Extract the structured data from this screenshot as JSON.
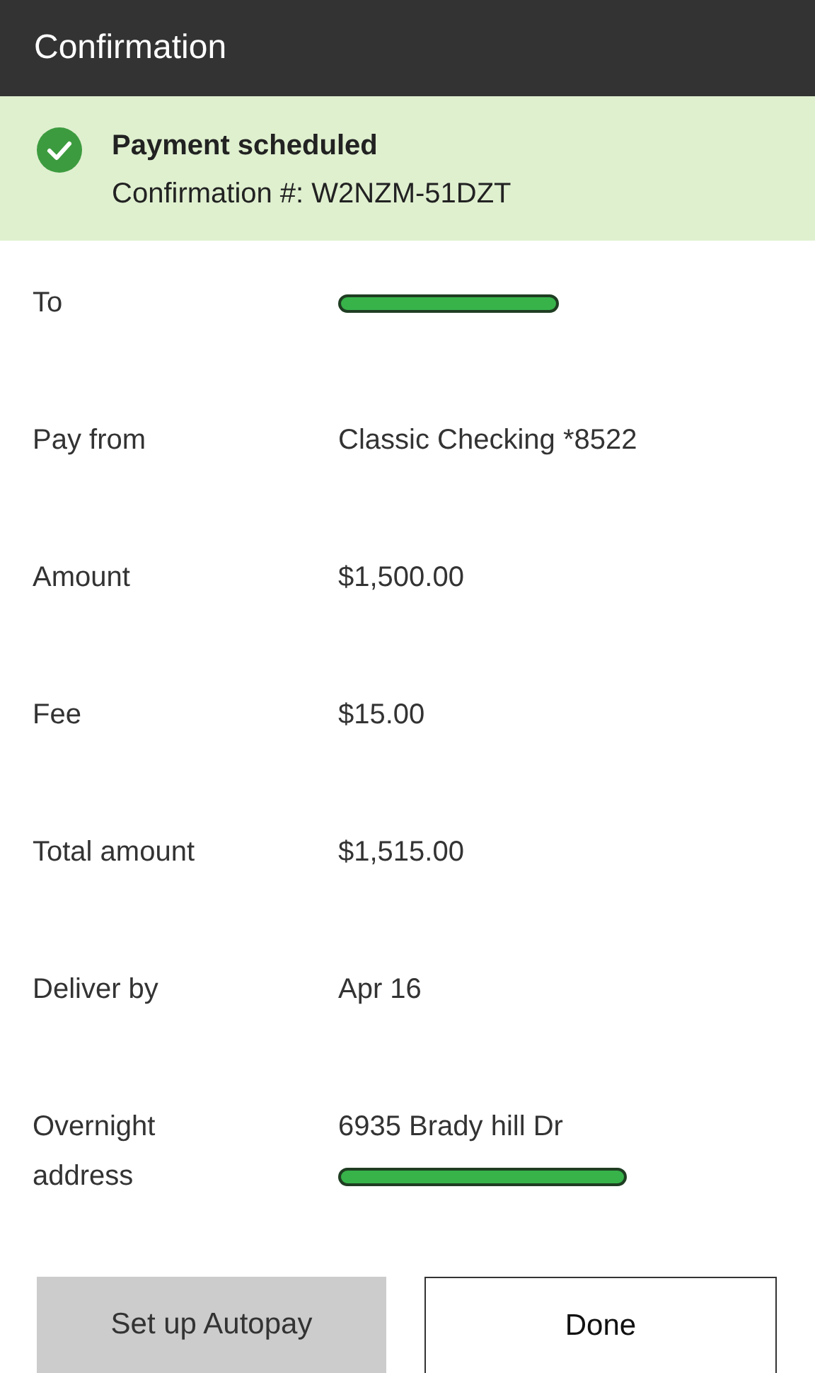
{
  "header": {
    "title": "Confirmation"
  },
  "banner": {
    "title": "Payment scheduled",
    "subtitle": "Confirmation #: W2NZM-51DZT"
  },
  "rows": [
    {
      "label": "To",
      "value": [
        {
          "kind": "redacted"
        }
      ]
    },
    {
      "label": "Pay from",
      "value": [
        {
          "kind": "text",
          "text": "Classic Checking *8522"
        }
      ]
    },
    {
      "label": "Amount",
      "value": [
        {
          "kind": "text",
          "text": "$1,500.00"
        }
      ]
    },
    {
      "label": "Fee",
      "value": [
        {
          "kind": "text",
          "text": "$15.00"
        }
      ]
    },
    {
      "label": "Total amount",
      "value": [
        {
          "kind": "text",
          "text": "$1,515.00"
        }
      ]
    },
    {
      "label": "Deliver by",
      "value": [
        {
          "kind": "text",
          "text": "Apr 16"
        }
      ]
    },
    {
      "label": "Overnight address",
      "value": [
        {
          "kind": "text",
          "text": "6935 Brady hill Dr"
        },
        {
          "kind": "redacted"
        }
      ]
    }
  ],
  "buttons": [
    {
      "label": "Set up Autopay",
      "kind": "secondary"
    },
    {
      "label": "Done",
      "kind": "primary"
    }
  ]
}
